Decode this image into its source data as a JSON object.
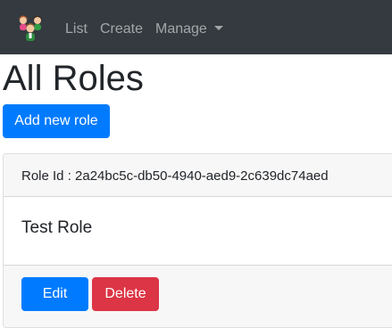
{
  "navbar": {
    "brand_icon": "users-icon",
    "items": [
      {
        "label": "List"
      },
      {
        "label": "Create"
      },
      {
        "label": "Manage"
      }
    ]
  },
  "page": {
    "title": "All Roles"
  },
  "actions": {
    "add_label": "Add new role"
  },
  "roles": [
    {
      "id_text": "Role Id : 2a24bc5c-db50-4940-aed9-2c639dc74aed",
      "name": "Test Role",
      "edit_label": "Edit",
      "delete_label": "Delete"
    }
  ],
  "colors": {
    "navbar_bg": "#343a40",
    "primary": "#007bff",
    "danger": "#dc3545"
  }
}
